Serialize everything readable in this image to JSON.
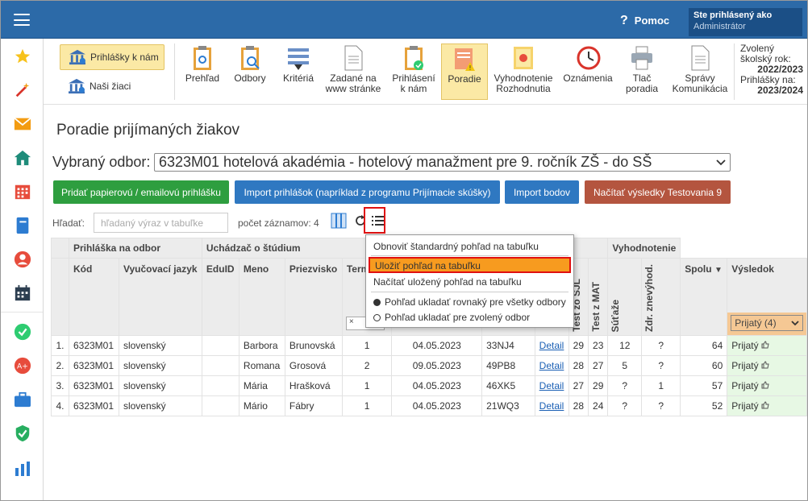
{
  "header": {
    "help_label": "Pomoc",
    "user_line1": "Ste prihlásený ako",
    "user_line2": "Administrátor"
  },
  "toolbar": {
    "prihlasky_label": "Prihlášky k nám",
    "ziaci_label": "Naši žiaci",
    "tools": [
      {
        "line1": "Prehľad",
        "line2": ""
      },
      {
        "line1": "Odbory",
        "line2": ""
      },
      {
        "line1": "Kritériá",
        "line2": ""
      },
      {
        "line1": "Zadané na",
        "line2": "www stránke"
      },
      {
        "line1": "Prihlásení",
        "line2": "k nám"
      },
      {
        "line1": "Poradie",
        "line2": ""
      },
      {
        "line1": "Vyhodnotenie",
        "line2": "Rozhodnutia"
      },
      {
        "line1": "Oznámenia",
        "line2": ""
      },
      {
        "line1": "Tlač",
        "line2": "poradia"
      },
      {
        "line1": "Správy",
        "line2": "Komunikácia"
      }
    ],
    "year_label1": "Zvolený",
    "year_label2": "školský rok:",
    "year_value": "2022/2023",
    "prihlasky_na_label": "Prihlášky na:",
    "prihlasky_na_value": "2023/2024"
  },
  "main": {
    "title": "Poradie prijímaných žiakov",
    "odbor_label": "Vybraný odbor:",
    "odbor_value": "6323M01 hotelová akadémia - hotelový manažment pre 9. ročník ZŠ - do SŠ",
    "buttons": {
      "add": "Pridať papierovú / emailovú prihlášku",
      "import_prihlasok": "Import prihlášok (napríklad z programu Prijímacie skúšky)",
      "import_bodov": "Import bodov",
      "nacitat": "Načítať výsledky Testovania 9"
    },
    "search_label": "Hľadať:",
    "search_placeholder": "hľadaný výraz v tabuľke",
    "count_label": "počet záznamov: 4"
  },
  "table": {
    "group_headers": {
      "prihlaska": "Prihláška na odbor",
      "uchadzac": "Uchádzač o štúdium",
      "vyhodnotenie": "Vyhodnotenie"
    },
    "columns": {
      "kod": "Kód",
      "jazyk": "Vyučovací jazyk",
      "eduid": "EduID",
      "meno": "Meno",
      "priezvisko": "Priezvisko",
      "termin": "Termín",
      "sjl": "Test zo SJL",
      "mat": "Test z MAT",
      "sutaze": "Súťaže",
      "zdr": "Zdr. znevýhod.",
      "spolu": "Spolu",
      "vysledok": "Výsledok"
    },
    "filter_small": "×",
    "filter_vysledok": "Prijatý (4)",
    "detail_label": "Detail",
    "rows": [
      {
        "n": "1.",
        "kod": "6323M01",
        "jazyk": "slovenský",
        "meno": "Barbora",
        "priezvisko": "Brunovská",
        "termin": "1",
        "datum": "04.05.2023",
        "kodcode": "33NJ4",
        "sjl": "29",
        "mat": "23",
        "sutaze": "12",
        "zdr": "?",
        "spolu": "64",
        "vysledok": "Prijatý"
      },
      {
        "n": "2.",
        "kod": "6323M01",
        "jazyk": "slovenský",
        "meno": "Romana",
        "priezvisko": "Grosová",
        "termin": "2",
        "datum": "09.05.2023",
        "kodcode": "49PB8",
        "sjl": "28",
        "mat": "27",
        "sutaze": "5",
        "zdr": "?",
        "spolu": "60",
        "vysledok": "Prijatý"
      },
      {
        "n": "3.",
        "kod": "6323M01",
        "jazyk": "slovenský",
        "meno": "Mária",
        "priezvisko": "Hrašková",
        "termin": "1",
        "datum": "04.05.2023",
        "kodcode": "46XK5",
        "sjl": "27",
        "mat": "29",
        "sutaze": "?",
        "zdr": "1",
        "spolu": "57",
        "vysledok": "Prijatý"
      },
      {
        "n": "4.",
        "kod": "6323M01",
        "jazyk": "slovenský",
        "meno": "Mário",
        "priezvisko": "Fábry",
        "termin": "1",
        "datum": "04.05.2023",
        "kodcode": "21WQ3",
        "sjl": "28",
        "mat": "24",
        "sutaze": "?",
        "zdr": "?",
        "spolu": "52",
        "vysledok": "Prijatý"
      }
    ]
  },
  "dropdown": {
    "item1": "Obnoviť štandardný pohľad na tabuľku",
    "item2": "Uložiť pohľad na tabuľku",
    "item3": "Načítať uložený pohľad na tabuľku",
    "radio1": "Pohľad ukladať rovnaký pre všetky odbory",
    "radio2": "Pohľad ukladať pre zvolený odbor"
  },
  "colors": {
    "topbar": "#2c6aa8",
    "green_button": "#2e9e3f",
    "blue_button": "#2f78c1",
    "red_button": "#b4553f",
    "highlight": "#f79b1f"
  }
}
